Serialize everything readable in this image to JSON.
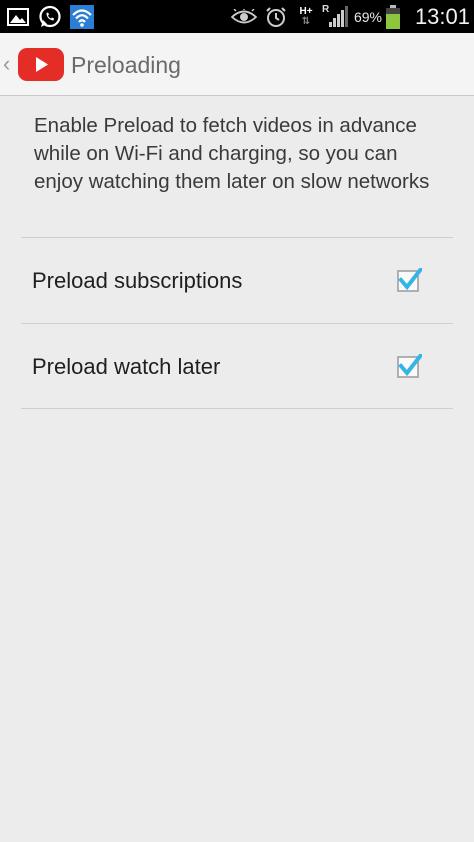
{
  "status_bar": {
    "battery_percent": "69%",
    "clock": "13:01",
    "network_type": "H+",
    "roaming": "R",
    "icons": [
      "gallery-icon",
      "whatsapp-icon",
      "wifi-notify-icon",
      "eye-icon",
      "alarm-icon",
      "signal-icon",
      "battery-icon"
    ],
    "battery_color": "#8cc63f"
  },
  "action_bar": {
    "title": "Preloading",
    "back_icon": "chevron-left-icon",
    "app_icon": "youtube-icon",
    "app_icon_color": "#e52d27"
  },
  "content": {
    "description": "Enable Preload to fetch videos in advance while on Wi-Fi and charging, so you can enjoy watching them later on slow networks",
    "preferences": [
      {
        "label": "Preload subscriptions",
        "checked": true
      },
      {
        "label": "Preload watch later",
        "checked": true
      }
    ],
    "checkbox_color": "#33b5e5"
  }
}
